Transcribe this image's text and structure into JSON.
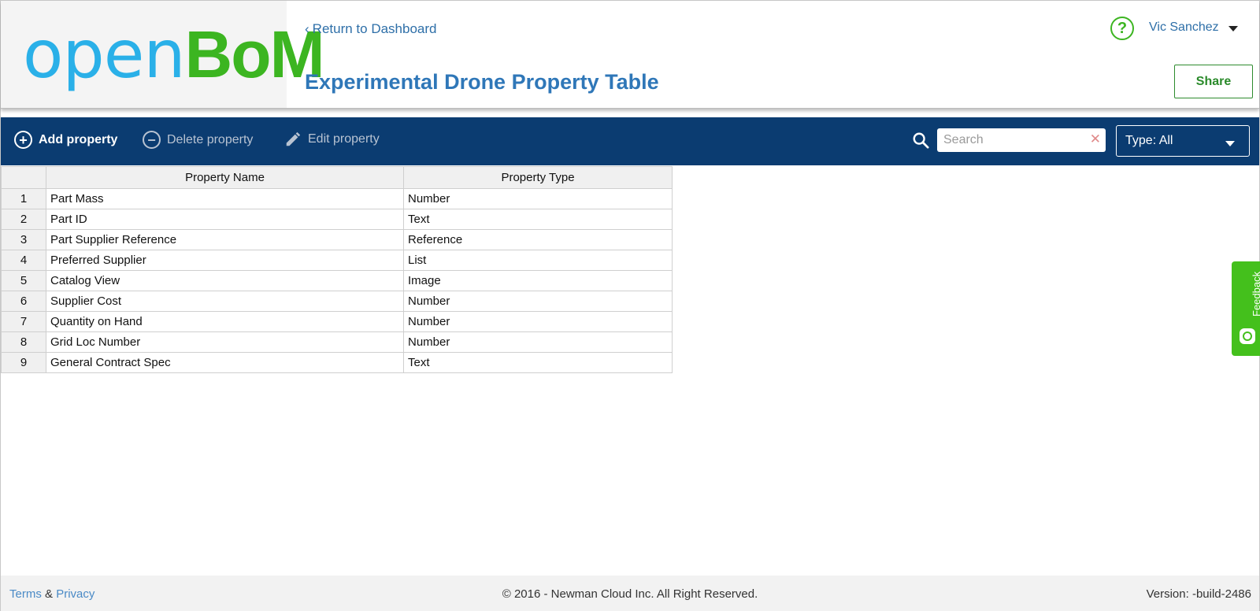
{
  "logo": {
    "part1": "open",
    "part2": "BoM"
  },
  "header": {
    "return_label": "Return to Dashboard",
    "title": "Experimental Drone Property Table",
    "user_name": "Vic Sanchez",
    "share_label": "Share",
    "help_glyph": "?"
  },
  "toolbar": {
    "add_label": "Add property",
    "delete_label": "Delete property",
    "edit_label": "Edit property",
    "search_placeholder": "Search",
    "type_filter": "Type: All",
    "colors": {
      "background": "#0b3c71",
      "active_text": "#ffffff",
      "disabled_text": "#b8c3d2"
    }
  },
  "table": {
    "headers": [
      "Property Name",
      "Property Type"
    ],
    "rows": [
      {
        "n": "1",
        "name": "Part Mass",
        "type": "Number"
      },
      {
        "n": "2",
        "name": "Part ID",
        "type": "Text"
      },
      {
        "n": "3",
        "name": "Part Supplier Reference",
        "type": "Reference"
      },
      {
        "n": "4",
        "name": "Preferred Supplier",
        "type": "List"
      },
      {
        "n": "5",
        "name": "Catalog View",
        "type": "Image"
      },
      {
        "n": "6",
        "name": "Supplier Cost",
        "type": "Number"
      },
      {
        "n": "7",
        "name": "Quantity on Hand",
        "type": "Number"
      },
      {
        "n": "8",
        "name": "Grid Loc Number",
        "type": "Number"
      },
      {
        "n": "9",
        "name": "General Contract Spec",
        "type": "Text"
      }
    ]
  },
  "feedback": {
    "label": "Feedback",
    "color": "#44c01c"
  },
  "footer": {
    "terms": "Terms",
    "amp": "&",
    "privacy": "Privacy",
    "copyright": "© 2016 - Newman Cloud Inc. All Right Reserved.",
    "version": "Version: -build-2486"
  },
  "icons": {
    "add": "plus-circle-icon",
    "delete": "minus-circle-icon",
    "edit": "pencil-icon",
    "search": "search-icon",
    "clear": "close-icon",
    "help": "question-circle-icon",
    "feedback": "chat-icon"
  }
}
